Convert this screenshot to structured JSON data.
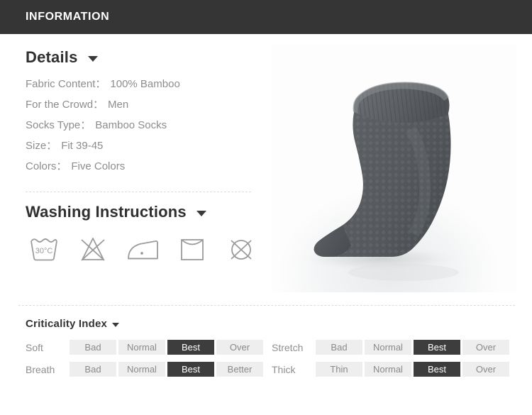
{
  "header": {
    "title": "INFORMATION"
  },
  "details": {
    "heading": "Details",
    "caret_icon": "chevron-down-icon",
    "rows": [
      {
        "label": "Fabric Content：",
        "value": "100% Bamboo"
      },
      {
        "label": "For the Crowd：",
        "value": "Men"
      },
      {
        "label": "Socks Type：",
        "value": "Bamboo Socks"
      },
      {
        "label": "Size：",
        "value": "Fit 39-45"
      },
      {
        "label": "Colors：",
        "value": "Five Colors"
      }
    ]
  },
  "washing": {
    "heading": "Washing Instructions",
    "caret_icon": "chevron-down-icon",
    "icons": [
      {
        "name": "wash-30c-icon",
        "label": "30°C",
        "temp": "30°C"
      },
      {
        "name": "do-not-bleach-icon",
        "label": "Do not bleach"
      },
      {
        "name": "iron-low-icon",
        "label": "Iron low heat"
      },
      {
        "name": "drip-dry-icon",
        "label": "Drip dry"
      },
      {
        "name": "do-not-dry-clean-icon",
        "label": "Do not dry clean"
      }
    ]
  },
  "product": {
    "image_name": "bamboo-sock-photo",
    "alt": "Dark gray bamboo sock with diamond texture"
  },
  "criticality": {
    "heading": "Criticality Index",
    "caret_icon": "chevron-down-icon",
    "rows": [
      {
        "label": "Soft",
        "cells": [
          "Bad",
          "Normal",
          "Best",
          "Over"
        ],
        "active": 2
      },
      {
        "label": "Stretch",
        "cells": [
          "Bad",
          "Normal",
          "Best",
          "Over"
        ],
        "active": 2
      },
      {
        "label": "Breath",
        "cells": [
          "Bad",
          "Normal",
          "Best",
          "Better"
        ],
        "active": 2
      },
      {
        "label": "Thick",
        "cells": [
          "Thin",
          "Normal",
          "Best",
          "Over"
        ],
        "active": 2
      }
    ]
  },
  "colors": {
    "header_bg": "#353535",
    "active_cell_bg": "#3d3d3d",
    "cell_bg": "#eeeeee",
    "muted_text": "#8d8d8d",
    "heading_text": "#2f2f2f"
  }
}
